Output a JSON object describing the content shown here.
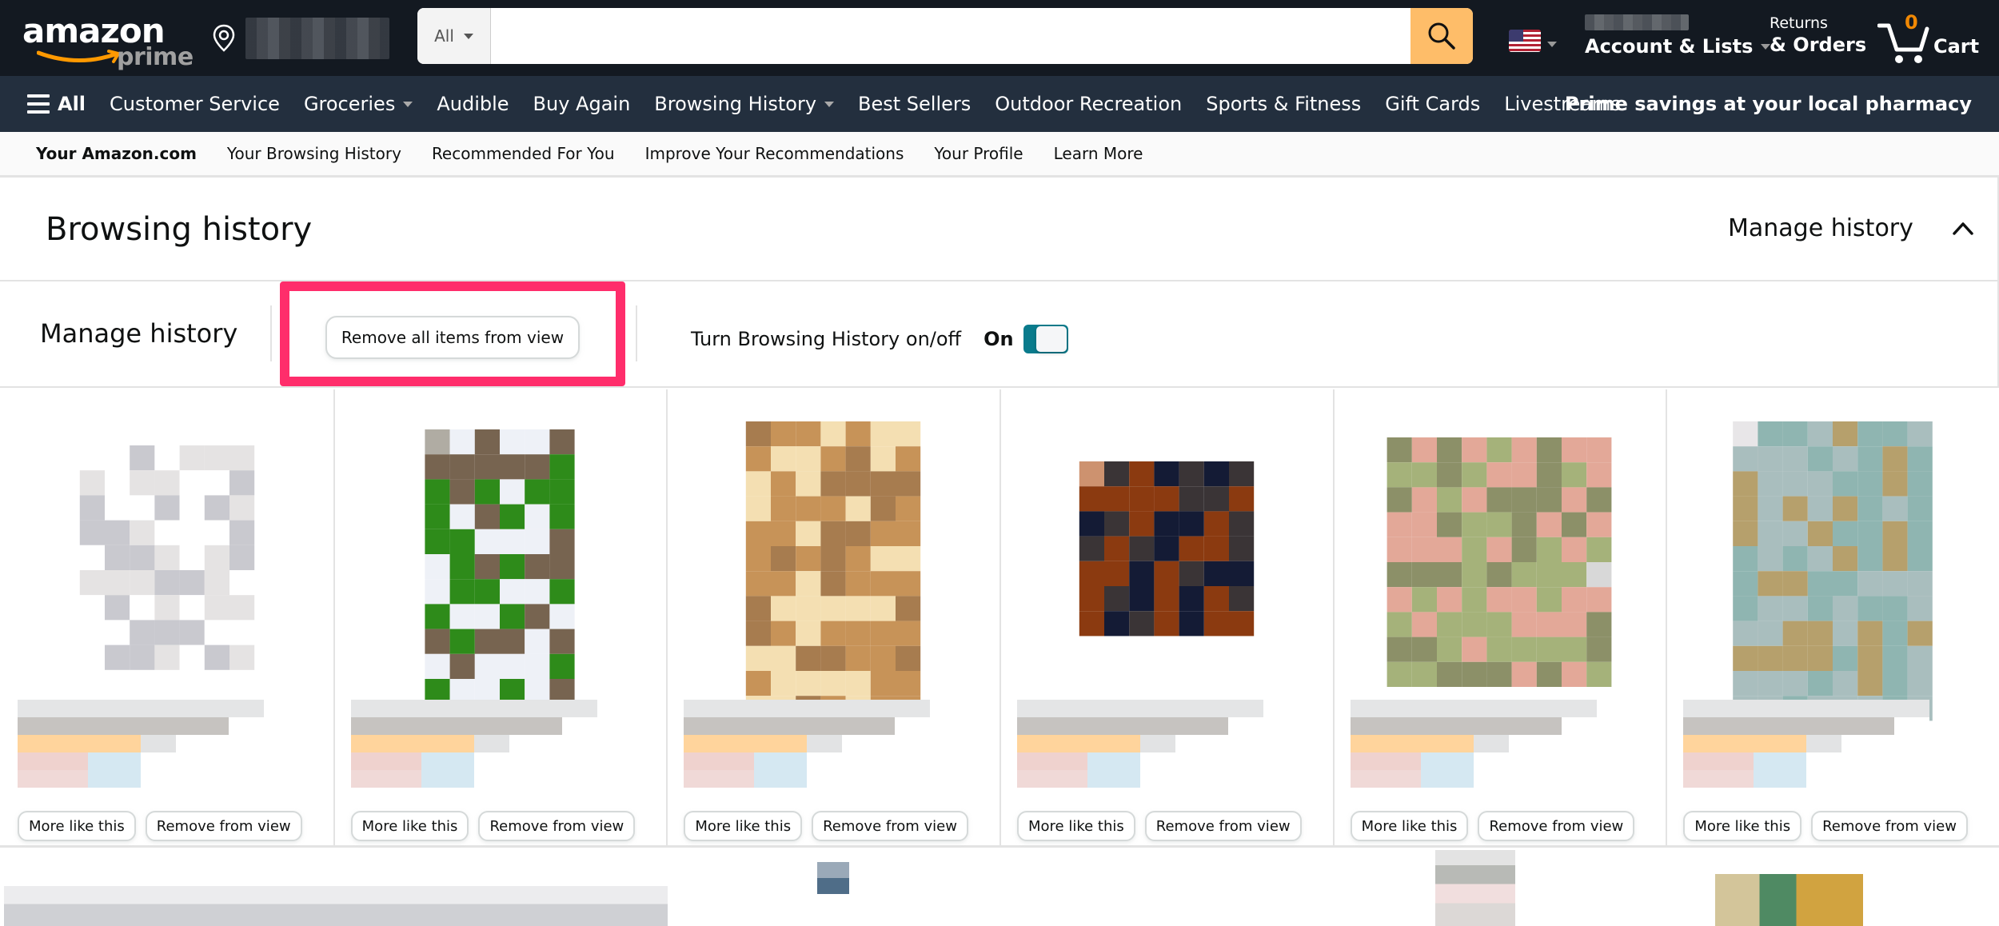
{
  "header": {
    "logo_text": "amazon",
    "logo_sub": "prime",
    "location_redacted": true,
    "search": {
      "category": "All",
      "placeholder": "",
      "value": ""
    },
    "account_line1_redacted": true,
    "account_label": "Account & Lists",
    "returns_line1": "Returns",
    "returns_line2": "& Orders",
    "cart_count": "0",
    "cart_label": "Cart"
  },
  "nav": {
    "all_label": "All",
    "items": [
      {
        "label": "Customer Service",
        "dropdown": false
      },
      {
        "label": "Groceries",
        "dropdown": true
      },
      {
        "label": "Audible",
        "dropdown": false
      },
      {
        "label": "Buy Again",
        "dropdown": false
      },
      {
        "label": "Browsing History",
        "dropdown": true
      },
      {
        "label": "Best Sellers",
        "dropdown": false
      },
      {
        "label": "Outdoor Recreation",
        "dropdown": false
      },
      {
        "label": "Sports & Fitness",
        "dropdown": false
      },
      {
        "label": "Gift Cards",
        "dropdown": false
      },
      {
        "label": "Livestreams",
        "dropdown": false
      }
    ],
    "promo": "Prime savings at your local pharmacy"
  },
  "subnav": {
    "items": [
      "Your Amazon.com",
      "Your Browsing History",
      "Recommended For You",
      "Improve Your Recommendations",
      "Your Profile",
      "Learn More"
    ]
  },
  "page": {
    "title": "Browsing history",
    "manage_toggle_label": "Manage history",
    "manage_row_label": "Manage history",
    "remove_all_label": "Remove all items from view",
    "toggle_label": "Turn Browsing History on/off",
    "toggle_state_label": "On",
    "toggle_on": true,
    "highlight_color": "#ff2d6b",
    "toggle_color": "#0a7b8c"
  },
  "products": [
    {
      "more_label": "More like this",
      "remove_label": "Remove from view",
      "palette": [
        "#ffffff",
        "#f2f0f0",
        "#e5e3e3",
        "#dcd8d6",
        "#c9c9cf",
        "#b5b7bd"
      ]
    },
    {
      "more_label": "More like this",
      "remove_label": "Remove from view",
      "palette": [
        "#eef1f7",
        "#b0aca3",
        "#776450",
        "#6e6461",
        "#2e8b1a",
        "#7a7775"
      ]
    },
    {
      "more_label": "More like this",
      "remove_label": "Remove from view",
      "palette": [
        "#f4dfb2",
        "#d6b98b",
        "#a77c4f",
        "#6a4b2c",
        "#c79358",
        "#d9b37c"
      ]
    },
    {
      "more_label": "More like this",
      "remove_label": "Remove from view",
      "palette": [
        "#141b35",
        "#3c445c",
        "#8b3a10",
        "#cd926f",
        "#3a3436",
        "#8a8e99"
      ]
    },
    {
      "more_label": "More like this",
      "remove_label": "Remove from view",
      "palette": [
        "#a5b27a",
        "#6d3f2d",
        "#e3a898",
        "#2f1a13",
        "#8c9068",
        "#d8d8d8"
      ]
    },
    {
      "more_label": "More like this",
      "remove_label": "Remove from view",
      "palette": [
        "#8fb5b1",
        "#d6d6da",
        "#b6a06c",
        "#c1c1c3",
        "#a9bebe",
        "#e8e6e8"
      ]
    }
  ]
}
